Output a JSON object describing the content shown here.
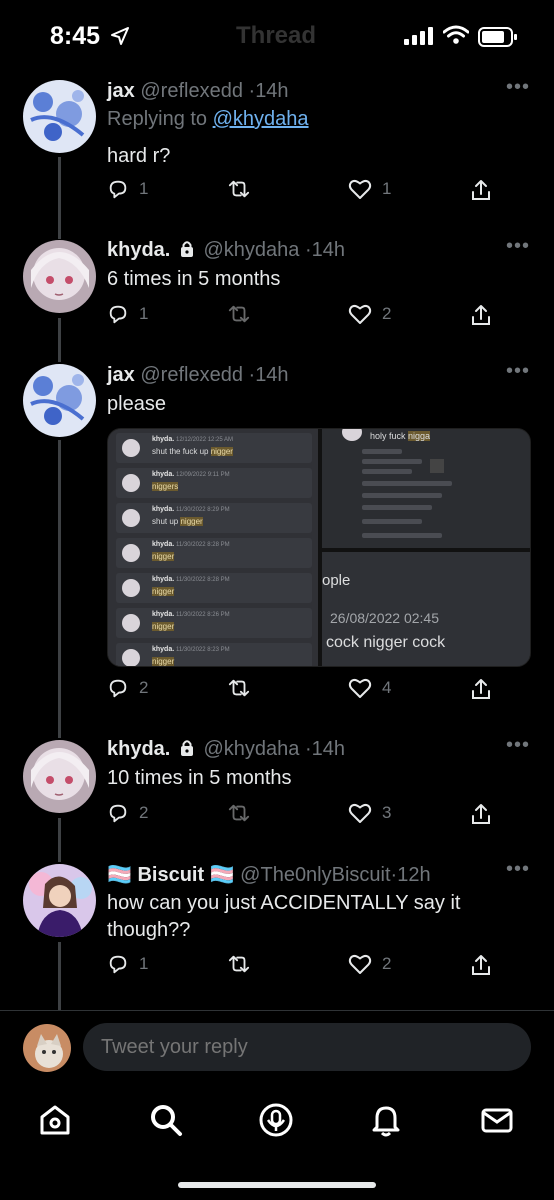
{
  "status_bar": {
    "time": "8:45",
    "ghost_title": "Thread"
  },
  "tweets": [
    {
      "name": "jax",
      "handle": "@reflexedd",
      "time": "14h",
      "replying_prefix": "Replying to ",
      "replying_to": "@khydaha",
      "text": "hard r?",
      "replies": "1",
      "retweets": "",
      "likes": "1"
    },
    {
      "name": "khyda.",
      "handle": "@khydaha",
      "time": "14h",
      "text": "6 times in 5 months",
      "replies": "1",
      "retweets": "",
      "likes": "2"
    },
    {
      "name": "jax",
      "handle": "@reflexedd",
      "time": "14h",
      "text": "please",
      "replies": "2",
      "retweets": "",
      "likes": "4"
    },
    {
      "name": "khyda.",
      "handle": "@khydaha",
      "time": "14h",
      "text": "10 times in 5 months",
      "replies": "2",
      "retweets": "",
      "likes": "3"
    },
    {
      "name": "🏳️‍⚧️ Biscuit 🏳️‍⚧️",
      "handle": "@The0nlyBiscuit",
      "time": "12h",
      "text": "how can you just ACCIDENTALLY say it though??",
      "replies": "1",
      "retweets": "",
      "likes": "2"
    }
  ],
  "media": {
    "messages": [
      {
        "name": "khyda.",
        "time": "12/12/2022 12:25 AM",
        "pre": "shut the fuck up ",
        "word": "nigger"
      },
      {
        "name": "khyda.",
        "time": "12/09/2022 9:11 PM",
        "pre": "",
        "word": "niggers"
      },
      {
        "name": "khyda.",
        "time": "11/30/2022 8:29 PM",
        "pre": "shut up ",
        "word": "nigger"
      },
      {
        "name": "khyda.",
        "time": "11/30/2022 8:28 PM",
        "pre": "",
        "word": "nigger"
      },
      {
        "name": "khyda.",
        "time": "11/30/2022 8:28 PM",
        "pre": "",
        "word": "nigger"
      },
      {
        "name": "khyda.",
        "time": "11/30/2022 8:26 PM",
        "pre": "",
        "word": "nigger"
      },
      {
        "name": "khyda.",
        "time": "11/30/2022 8:23 PM",
        "pre": "",
        "word": "nigger"
      }
    ],
    "right_top_pre": "holy fuck ",
    "right_top_word": "nigga",
    "right_bottom_partial": "ople",
    "right_bottom_timestamp": "26/08/2022 02:45",
    "right_bottom_message": "cock nigger cock"
  },
  "reply_bar": {
    "placeholder": "Tweet your reply"
  },
  "icons": [
    "location-arrow-icon",
    "signal-icon",
    "wifi-icon",
    "battery-icon",
    "reply-icon",
    "retweet-icon",
    "like-icon",
    "share-icon",
    "more-icon",
    "lock-icon",
    "home-icon",
    "search-icon",
    "spaces-icon",
    "notifications-icon",
    "messages-icon"
  ],
  "colors": {
    "background": "#000000",
    "text": "#e7e9ea",
    "muted": "#71767b",
    "link": "#6fb1ee",
    "thread_line": "#3e4144"
  }
}
